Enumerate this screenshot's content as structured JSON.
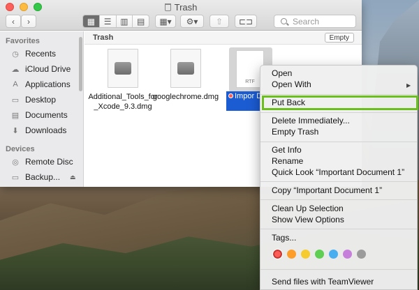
{
  "window": {
    "title": "Trash"
  },
  "toolbar": {
    "search_placeholder": "Search",
    "back_icon": "chevron-left-icon",
    "forward_icon": "chevron-right-icon"
  },
  "sidebar": {
    "favorites_header": "Favorites",
    "favorites": [
      {
        "label": "Recents",
        "icon": "clock-icon"
      },
      {
        "label": "iCloud Drive",
        "icon": "cloud-icon"
      },
      {
        "label": "Applications",
        "icon": "applications-icon"
      },
      {
        "label": "Desktop",
        "icon": "desktop-icon"
      },
      {
        "label": "Documents",
        "icon": "document-icon"
      },
      {
        "label": "Downloads",
        "icon": "download-icon"
      }
    ],
    "devices_header": "Devices",
    "devices": [
      {
        "label": "Remote Disc",
        "icon": "disc-icon"
      },
      {
        "label": "Backup...",
        "icon": "drive-icon"
      }
    ]
  },
  "content": {
    "path_title": "Trash",
    "empty_label": "Empty",
    "files": [
      {
        "name": "Additional_Tools_for_Xcode_9.3.dmg"
      },
      {
        "name": "googlechrome.dmg"
      },
      {
        "name": "Important Document 1",
        "badge": "RTF",
        "visible_label": "Impor Docum"
      }
    ]
  },
  "menu": {
    "group1": [
      "Open",
      "Open With"
    ],
    "group2": [
      "Put Back"
    ],
    "group3": [
      "Delete Immediately...",
      "Empty Trash"
    ],
    "group4": [
      "Get Info",
      "Rename",
      "Quick Look “Important Document 1”"
    ],
    "group5": [
      "Copy “Important Document 1”"
    ],
    "group6": [
      "Clean Up Selection",
      "Show View Options"
    ],
    "group7": [
      "Tags..."
    ],
    "group8": [
      "Send files with TeamViewer"
    ],
    "tag_colors": [
      "#fc5c56",
      "#fd9e2b",
      "#f6cb30",
      "#5fcf53",
      "#49aef0",
      "#c77fdc",
      "#9b9b9b"
    ]
  },
  "colors": {
    "highlight_border": "#6abf1c",
    "selection_blue": "#1c5cd3"
  }
}
